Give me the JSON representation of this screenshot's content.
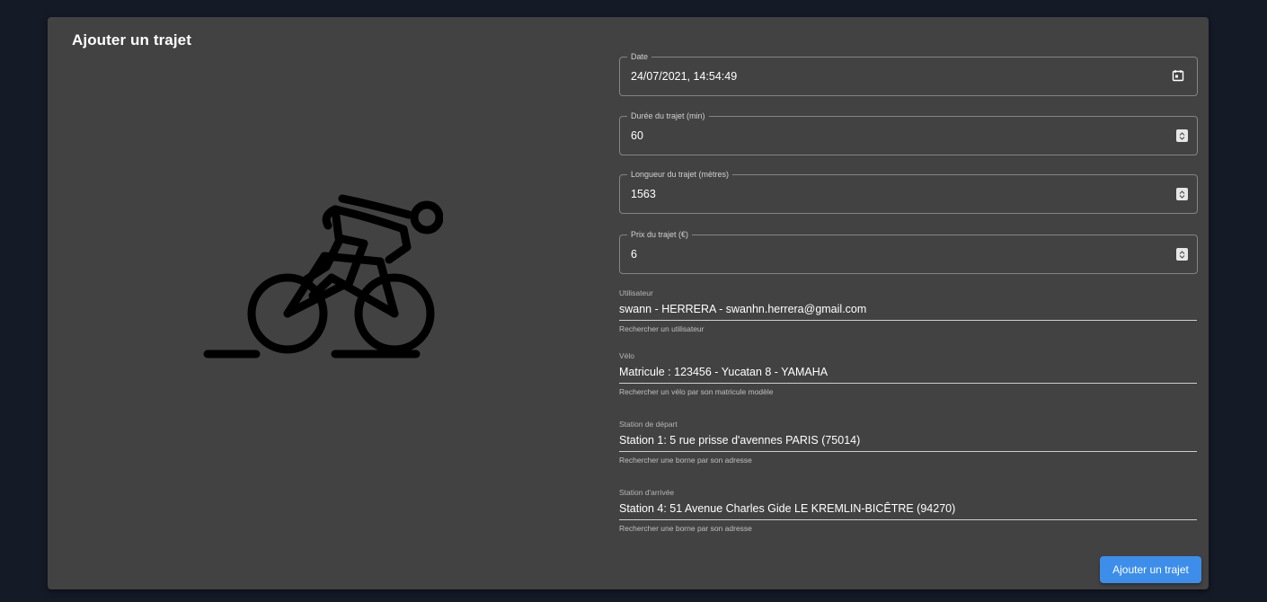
{
  "card": {
    "title": "Ajouter un trajet"
  },
  "fields": {
    "date": {
      "label": "Date",
      "value": "24/07/2021, 14:54:49",
      "icon": "calendar-icon"
    },
    "duration": {
      "label": "Durée du trajet (min)",
      "value": "60"
    },
    "length": {
      "label": "Longueur du trajet (mètres)",
      "value": "1563"
    },
    "price": {
      "label": "Prix du trajet (€)",
      "value": "6"
    }
  },
  "autocomplete": {
    "user": {
      "label": "Utilisateur",
      "value": "swann - HERRERA - swanhn.herrera@gmail.com",
      "helper": "Rechercher un utilisateur"
    },
    "bike": {
      "label": "Vélo",
      "value": "Matricule : 123456 - Yucatan 8 - YAMAHA",
      "helper": "Rechercher un vélo par son matricule modèle"
    },
    "departure": {
      "label": "Station de départ",
      "value": "Station 1: 5 rue prisse d'avennes PARIS (75014)",
      "helper": "Rechercher une borne par son adresse"
    },
    "arrival": {
      "label": "Station d'arrivée",
      "value": "Station 4: 51 Avenue Charles Gide LE KREMLIN-BICÊTRE (94270)",
      "helper": "Rechercher une borne par son adresse"
    }
  },
  "actions": {
    "submit_label": "Ajouter un trajet"
  },
  "illustration": {
    "icon": "cyclist-icon"
  },
  "colors": {
    "background": "#141a26",
    "card": "#424242",
    "primary": "#3d8eea"
  }
}
